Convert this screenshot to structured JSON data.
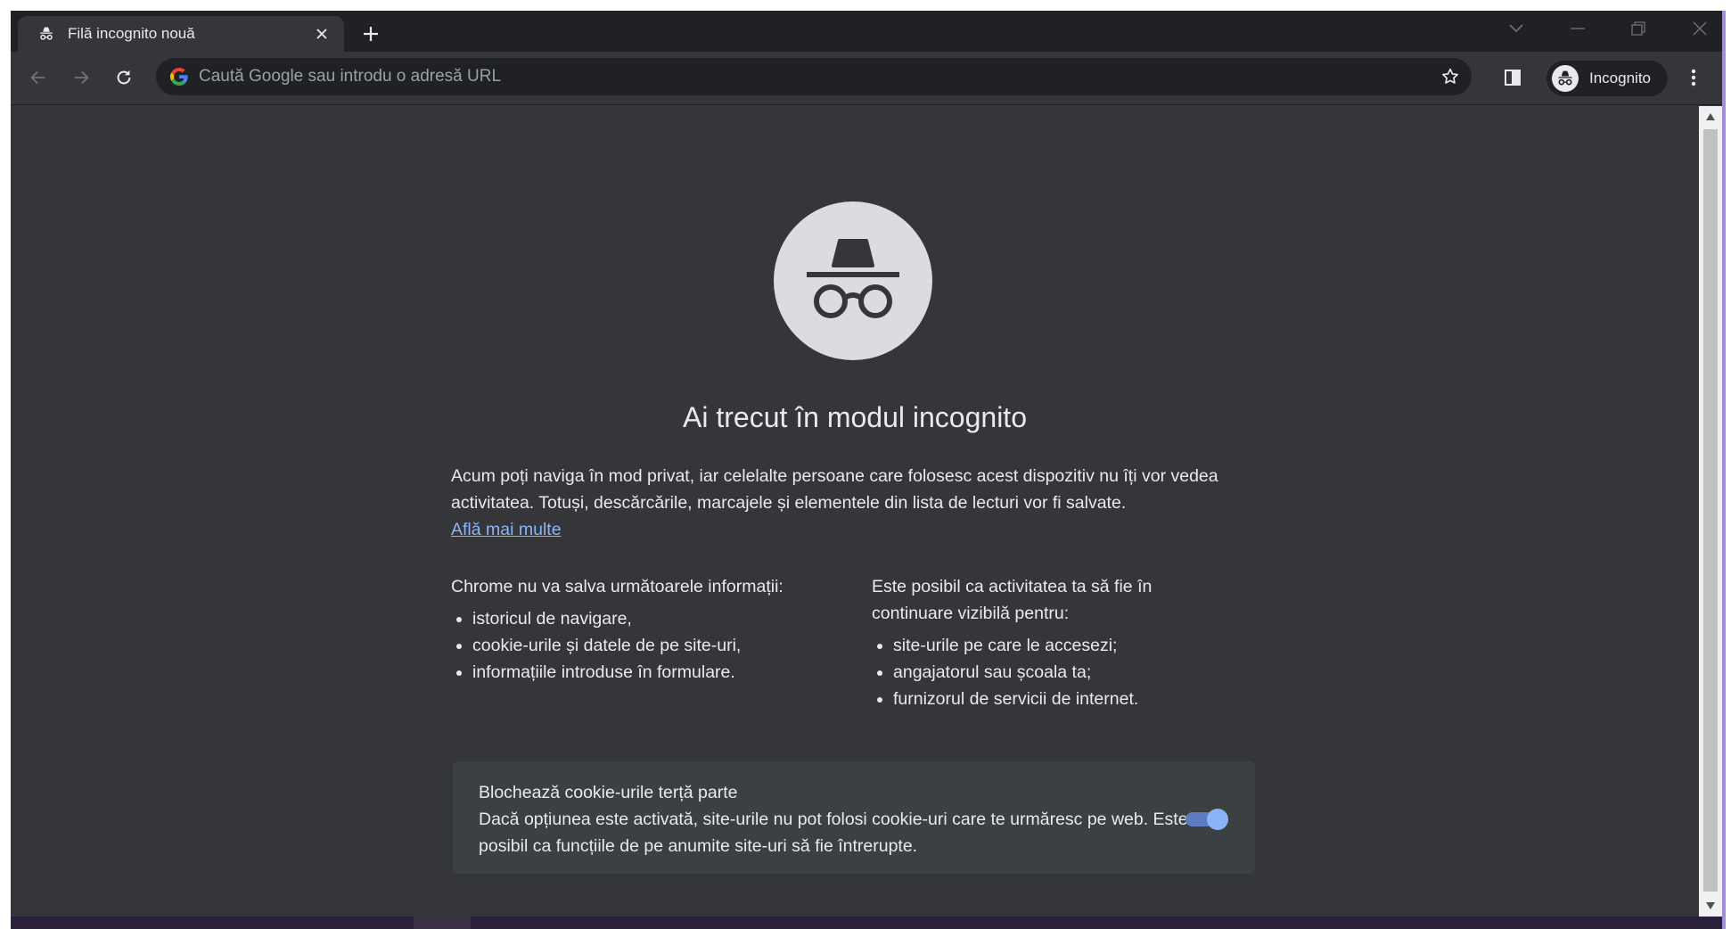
{
  "tab": {
    "title": "Filă incognito nouă",
    "favicon": "incognito-icon"
  },
  "toolbar": {
    "omnibox_placeholder": "Caută Google sau introdu o adresă URL",
    "profile_label": "Incognito"
  },
  "page": {
    "heading": "Ai trecut în modul incognito",
    "intro": "Acum poți naviga în mod privat, iar celelalte persoane care folosesc acest dispozitiv nu îți vor vedea activitatea. Totuși, descărcările, marcajele și elementele din lista de lecturi vor fi salvate.",
    "learn_more": "Află mai multe",
    "left_column": {
      "title": "Chrome nu va salva următoarele informații:",
      "items": [
        "istoricul de navigare,",
        "cookie-urile și datele de pe site-uri,",
        "informațiile introduse în formulare."
      ]
    },
    "right_column": {
      "title": "Este posibil ca activitatea ta să fie în continuare vizibilă pentru:",
      "items": [
        "site-urile pe care le accesezi;",
        "angajatorul sau școala ta;",
        "furnizorul de servicii de internet."
      ]
    },
    "cookie_card": {
      "title": "Blochează cookie-urile terță parte",
      "description": "Dacă opțiunea este activată, site-urile nu pot folosi cookie-uri care te urmăresc pe web. Este posibil ca funcțiile de pe anumite site-uri să fie întrerupte.",
      "toggle_on": true
    }
  },
  "colors": {
    "frame": "#202124",
    "toolbar": "#35363a",
    "accent": "#8ab4f8",
    "text": "#e8eaed"
  }
}
